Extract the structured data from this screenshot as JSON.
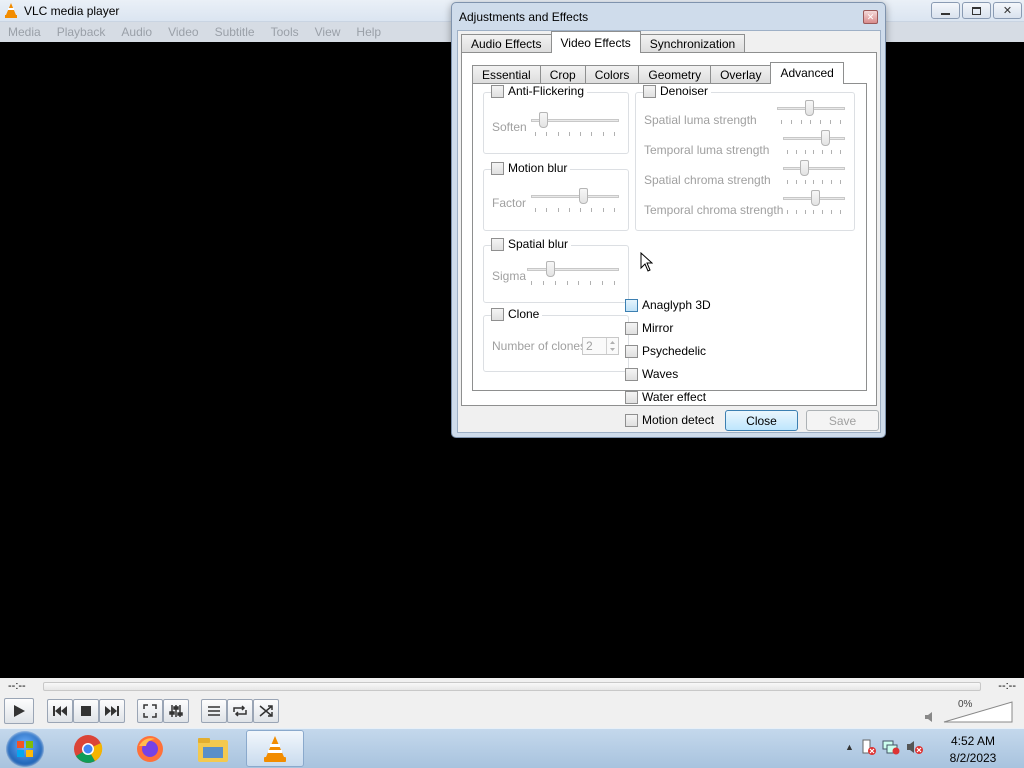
{
  "app": {
    "title": "VLC media player",
    "menu": [
      "Media",
      "Playback",
      "Audio",
      "Video",
      "Subtitle",
      "Tools",
      "View",
      "Help"
    ]
  },
  "player": {
    "time_elapsed": "--:--",
    "time_remaining": "--:--",
    "volume": "0%"
  },
  "dialog": {
    "title": "Adjustments and Effects",
    "top_tabs": [
      "Audio Effects",
      "Video Effects",
      "Synchronization"
    ],
    "active_top_tab": "Video Effects",
    "sub_tabs": [
      "Essential",
      "Crop",
      "Colors",
      "Geometry",
      "Overlay",
      "Advanced"
    ],
    "active_sub_tab": "Advanced",
    "anti_flickering": {
      "label": "Anti-Flickering",
      "soften_label": "Soften"
    },
    "motion_blur": {
      "label": "Motion blur",
      "factor_label": "Factor"
    },
    "spatial_blur": {
      "label": "Spatial blur",
      "sigma_label": "Sigma"
    },
    "clone": {
      "label": "Clone",
      "number_label": "Number of clones",
      "number_value": "2"
    },
    "denoiser": {
      "label": "Denoiser",
      "spatial_luma": "Spatial luma strength",
      "temporal_luma": "Temporal luma strength",
      "spatial_chroma": "Spatial chroma strength",
      "temporal_chroma": "Temporal chroma strength"
    },
    "effects": [
      "Anaglyph 3D",
      "Mirror",
      "Psychedelic",
      "Waves",
      "Water effect",
      "Motion detect"
    ],
    "close_label": "Close",
    "save_label": "Save"
  },
  "taskbar": {
    "time": "4:52 AM",
    "date": "8/2/2023"
  },
  "colors": {
    "vlc_orange": "#f28c00",
    "dialog_frame": "#cfdceb",
    "primary_button": "#bee6fd"
  }
}
